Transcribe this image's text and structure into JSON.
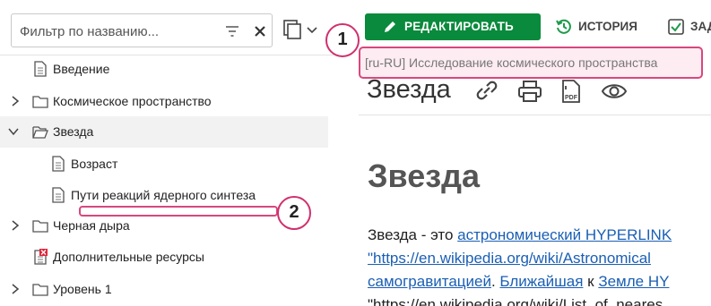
{
  "sidebar": {
    "filter": {
      "placeholder": "Фильтр по названию...",
      "value": ""
    },
    "tree": [
      {
        "label": "Введение",
        "icon": "document-icon",
        "chevron": ""
      },
      {
        "label": "Космическое пространство",
        "icon": "folder-icon",
        "chevron": "collapsed"
      },
      {
        "label": "Звезда",
        "icon": "folder-open-icon",
        "chevron": "expanded",
        "selected": true
      },
      {
        "label": "Возраст",
        "icon": "document-icon",
        "chevron": ""
      },
      {
        "label": "Пути реакций ядерного синтеза",
        "icon": "document-icon",
        "chevron": ""
      },
      {
        "label": "Черная дыра",
        "icon": "folder-icon",
        "chevron": "collapsed"
      },
      {
        "label": "Дополнительные ресурсы",
        "icon": "document-error-icon",
        "chevron": ""
      },
      {
        "label": "Уровень 1",
        "icon": "folder-icon",
        "chevron": "collapsed"
      }
    ]
  },
  "toolbar": {
    "edit_label": "РЕДАКТИРОВАТЬ",
    "history_label": "ИСТОРИЯ",
    "tasks_label": "ЗАД"
  },
  "breadcrumb": "[ru-RU] Исследование космического пространства",
  "page": {
    "title": "Звезда",
    "heading": "Звезда",
    "lines": [
      {
        "text": "Звезда - это ",
        "link": "астрономический HYPERLINK"
      },
      {
        "text": "",
        "link": "\"https://en.wikipedia.org/wiki/Astronomical"
      },
      {
        "link1": "самогравитацией",
        "sep": ". ",
        "link2": "Ближайшая",
        "mid": " к ",
        "link3": "Земле HY"
      },
      {
        "text": "\"https://en.wikipedia.org/wiki/List_of_neares"
      }
    ]
  },
  "annotations": {
    "callout_1": "1",
    "callout_2": "2"
  },
  "colors": {
    "accent_green": "#0a8a3c",
    "highlight_pink": "#d8477e",
    "link_blue": "#1a5fb4"
  }
}
